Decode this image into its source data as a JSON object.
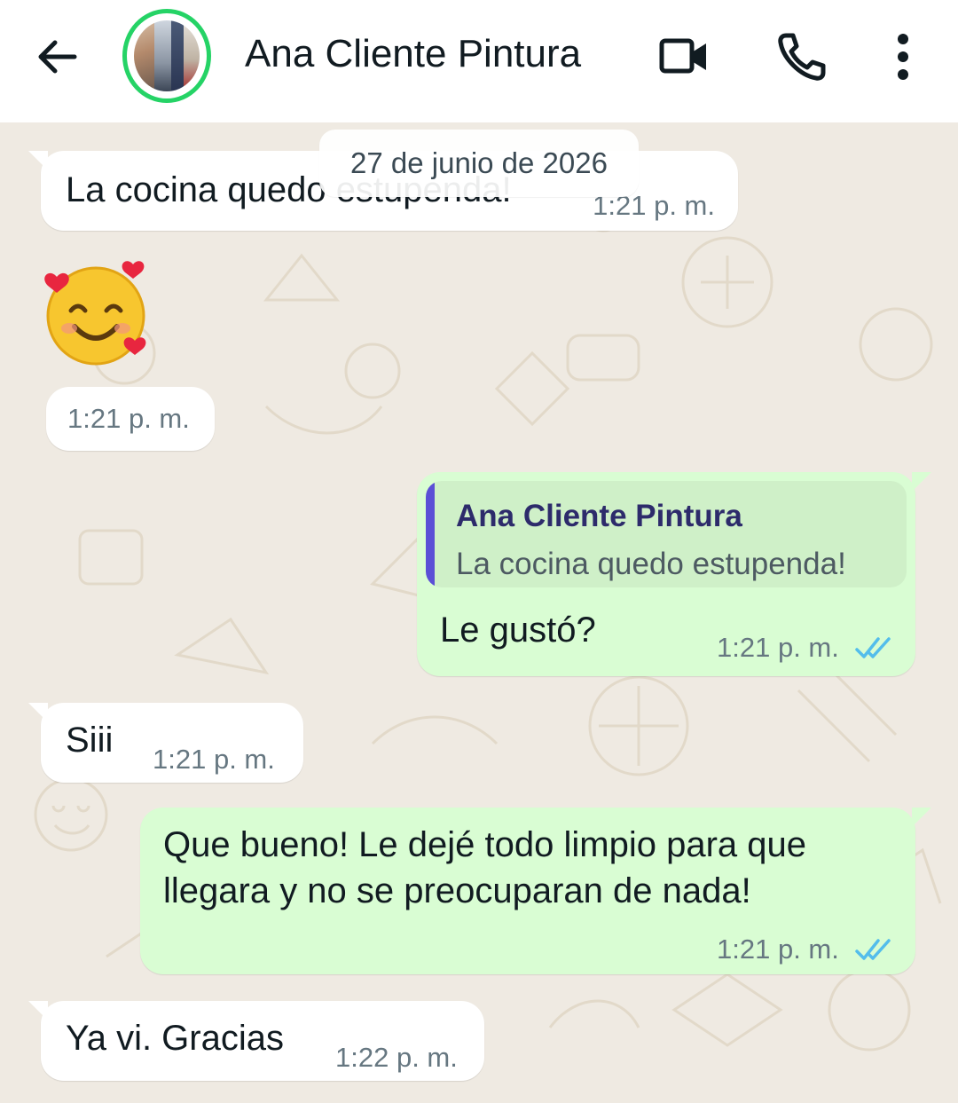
{
  "header": {
    "contact_name": "Ana Cliente Pintura",
    "icons": [
      "back-arrow-icon",
      "video-call-icon",
      "phone-call-icon",
      "more-vert-icon"
    ]
  },
  "chat": {
    "date_separator": "27 de junio de 2026",
    "messages": [
      {
        "direction": "incoming",
        "text": "La cocina quedo estupenda!",
        "time": "1:21 p. m."
      },
      {
        "direction": "incoming",
        "emoji": "smiling-face-with-hearts",
        "time": "1:21 p. m."
      },
      {
        "direction": "outgoing",
        "reply_to": {
          "name": "Ana Cliente Pintura",
          "text": "La cocina quedo estupenda!"
        },
        "text": "Le gustó?",
        "time": "1:21 p. m.",
        "status": "read"
      },
      {
        "direction": "incoming",
        "text": "Siii",
        "time": "1:21 p. m."
      },
      {
        "direction": "outgoing",
        "lines": [
          "Que bueno! Le dejé todo limpio para que",
          "llegara y no se preocuparan de nada!"
        ],
        "time": "1:21 p. m.",
        "status": "read"
      },
      {
        "direction": "incoming",
        "text": "Ya vi. Gracias",
        "time": "1:22 p. m."
      }
    ]
  },
  "colors": {
    "header_bg": "#ffffff",
    "chat_bg": "#efeae2",
    "incoming_bubble": "#ffffff",
    "outgoing_bubble": "#d9fdd3",
    "read_ticks": "#53bdeb",
    "status_ring": "#25d366",
    "quote_bar": "#5b4fd6"
  }
}
